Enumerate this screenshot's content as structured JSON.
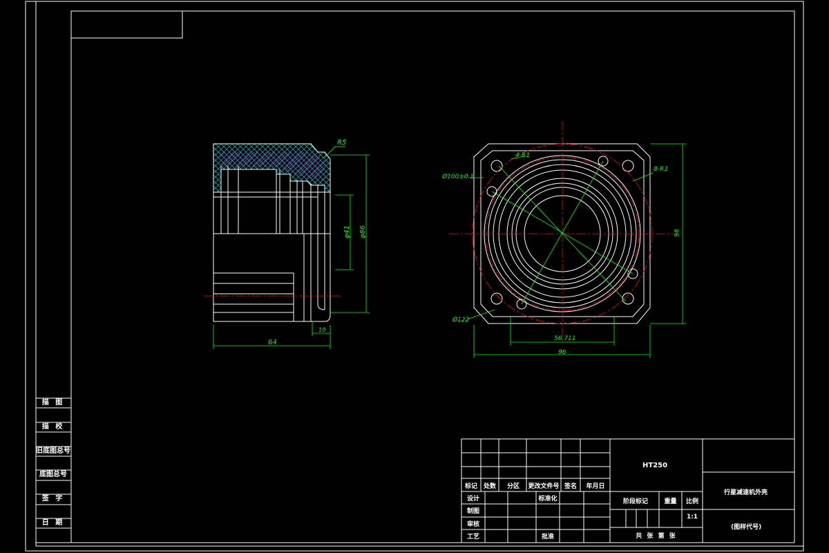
{
  "side_labels": [
    "描 图",
    "描 校",
    "旧底图总号",
    "底图总号",
    "签 字",
    "日 期"
  ],
  "dimensions": {
    "r5": "R5",
    "phi41": "φ41",
    "phi86": "φ86",
    "len64": "64",
    "len10": "10",
    "r1": "4-R1",
    "r3": "8-R3",
    "phi100": "Ø100±0.1",
    "phi122": "Ø122",
    "len56": "56.711",
    "len96_h": "96",
    "len96_v": "96"
  },
  "title_block": {
    "material": "HT250",
    "part_name": "行星减速机外壳",
    "drawing_code": "(图样代号)",
    "headers": [
      "标记",
      "处数",
      "分区",
      "更改文件号",
      "签名",
      "年月日"
    ],
    "design": "设计",
    "standardize": "标准化",
    "drafting": "制图",
    "review": "审核",
    "process": "工艺",
    "approve": "批准",
    "stage_mark": "阶段标记",
    "weight": "重量",
    "scale_label": "比例",
    "scale": "1:1",
    "sheets": "共 张 第 张"
  },
  "colors": {
    "line": "#ffffff",
    "dim": "#00ff00",
    "center": "#ff0000",
    "hatch": "#ff00ff",
    "cross": "#00ffff"
  }
}
